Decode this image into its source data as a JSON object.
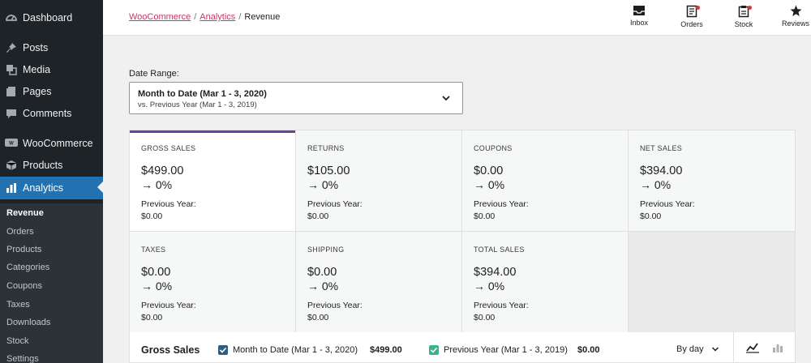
{
  "sidebar": {
    "items": [
      {
        "label": "Dashboard",
        "icon": "dashboard-icon"
      },
      {
        "label": "Posts",
        "icon": "pin-icon"
      },
      {
        "label": "Media",
        "icon": "media-icon"
      },
      {
        "label": "Pages",
        "icon": "pages-icon"
      },
      {
        "label": "Comments",
        "icon": "comment-icon"
      },
      {
        "label": "WooCommerce",
        "icon": "woocommerce-icon"
      },
      {
        "label": "Products",
        "icon": "box-icon"
      },
      {
        "label": "Analytics",
        "icon": "bar-chart-icon"
      }
    ],
    "submenu": [
      "Revenue",
      "Orders",
      "Products",
      "Categories",
      "Coupons",
      "Taxes",
      "Downloads",
      "Stock",
      "Settings"
    ]
  },
  "header": {
    "breadcrumb": {
      "root": "WooCommerce",
      "parent": "Analytics",
      "current": "Revenue",
      "separator": "/"
    },
    "buttons": [
      {
        "label": "Inbox",
        "icon": "inbox-icon",
        "badge": false
      },
      {
        "label": "Orders",
        "icon": "orders-icon",
        "badge": true
      },
      {
        "label": "Stock",
        "icon": "stock-icon",
        "badge": true
      },
      {
        "label": "Reviews",
        "icon": "star-icon",
        "badge": false
      }
    ]
  },
  "date_range": {
    "label": "Date Range:",
    "primary": "Month to Date (Mar 1 - 3, 2020)",
    "compare": "vs. Previous Year (Mar 1 - 3, 2019)"
  },
  "summary": {
    "tiles": [
      {
        "label": "GROSS SALES",
        "value": "$499.00",
        "delta": "→ 0%",
        "prev_label": "Previous Year:",
        "prev_value": "$0.00"
      },
      {
        "label": "RETURNS",
        "value": "$105.00",
        "delta": "→ 0%",
        "prev_label": "Previous Year:",
        "prev_value": "$0.00"
      },
      {
        "label": "COUPONS",
        "value": "$0.00",
        "delta": "→ 0%",
        "prev_label": "Previous Year:",
        "prev_value": "$0.00"
      },
      {
        "label": "NET SALES",
        "value": "$394.00",
        "delta": "→ 0%",
        "prev_label": "Previous Year:",
        "prev_value": "$0.00"
      },
      {
        "label": "TAXES",
        "value": "$0.00",
        "delta": "→ 0%",
        "prev_label": "Previous Year:",
        "prev_value": "$0.00"
      },
      {
        "label": "SHIPPING",
        "value": "$0.00",
        "delta": "→ 0%",
        "prev_label": "Previous Year:",
        "prev_value": "$0.00"
      },
      {
        "label": "TOTAL SALES",
        "value": "$394.00",
        "delta": "→ 0%",
        "prev_label": "Previous Year:",
        "prev_value": "$0.00"
      }
    ]
  },
  "chart_header": {
    "title": "Gross Sales",
    "legend": [
      {
        "label": "Month to Date (Mar 1 - 3, 2020)",
        "value": "$499.00",
        "checked": true,
        "color": "#2f5f7f"
      },
      {
        "label": "Previous Year (Mar 1 - 3, 2019)",
        "value": "$0.00",
        "checked": true,
        "color": "#3bb28a"
      }
    ],
    "interval": "By day"
  },
  "colors": {
    "sidebar_bg": "#1d2327",
    "accent": "#2271b1",
    "breadcrumb_link": "#c9356e",
    "selected_tile": "#674399"
  }
}
